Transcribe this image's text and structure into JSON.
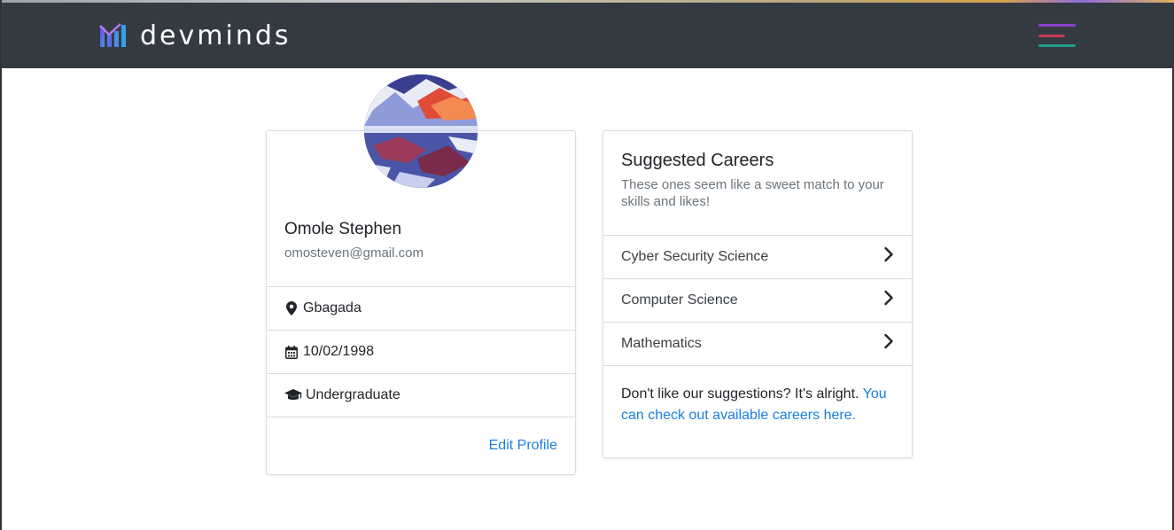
{
  "brand": {
    "name": "devminds",
    "logo_icon": "devminds-logo-icon"
  },
  "nav": {
    "menu_icon": "hamburger-menu-icon",
    "menu_colors": [
      "#8b3fc7",
      "#c23a5a",
      "#1f9e8b"
    ]
  },
  "profile": {
    "avatar_icon": "profile-avatar-image",
    "name": "Omole Stephen",
    "email": "omosteven@gmail.com",
    "location": "Gbagada",
    "location_icon": "map-marker-icon",
    "dob": "10/02/1998",
    "dob_icon": "calendar-icon",
    "education": "Undergraduate",
    "education_icon": "graduation-cap-icon",
    "edit_label": "Edit Profile"
  },
  "careers": {
    "title": "Suggested Careers",
    "subtitle": "These ones seem like a sweet match to your skills and likes!",
    "items": [
      {
        "label": "Cyber Security Science"
      },
      {
        "label": "Computer Science"
      },
      {
        "label": "Mathematics"
      }
    ],
    "chevron_icon": "chevron-right-icon",
    "footer_text": "Don't like our suggestions? It's alright. ",
    "footer_link": "You can check out available careers here."
  },
  "colors": {
    "navbar": "#343a42",
    "link": "#1a7fe0",
    "muted": "#6c757d"
  }
}
